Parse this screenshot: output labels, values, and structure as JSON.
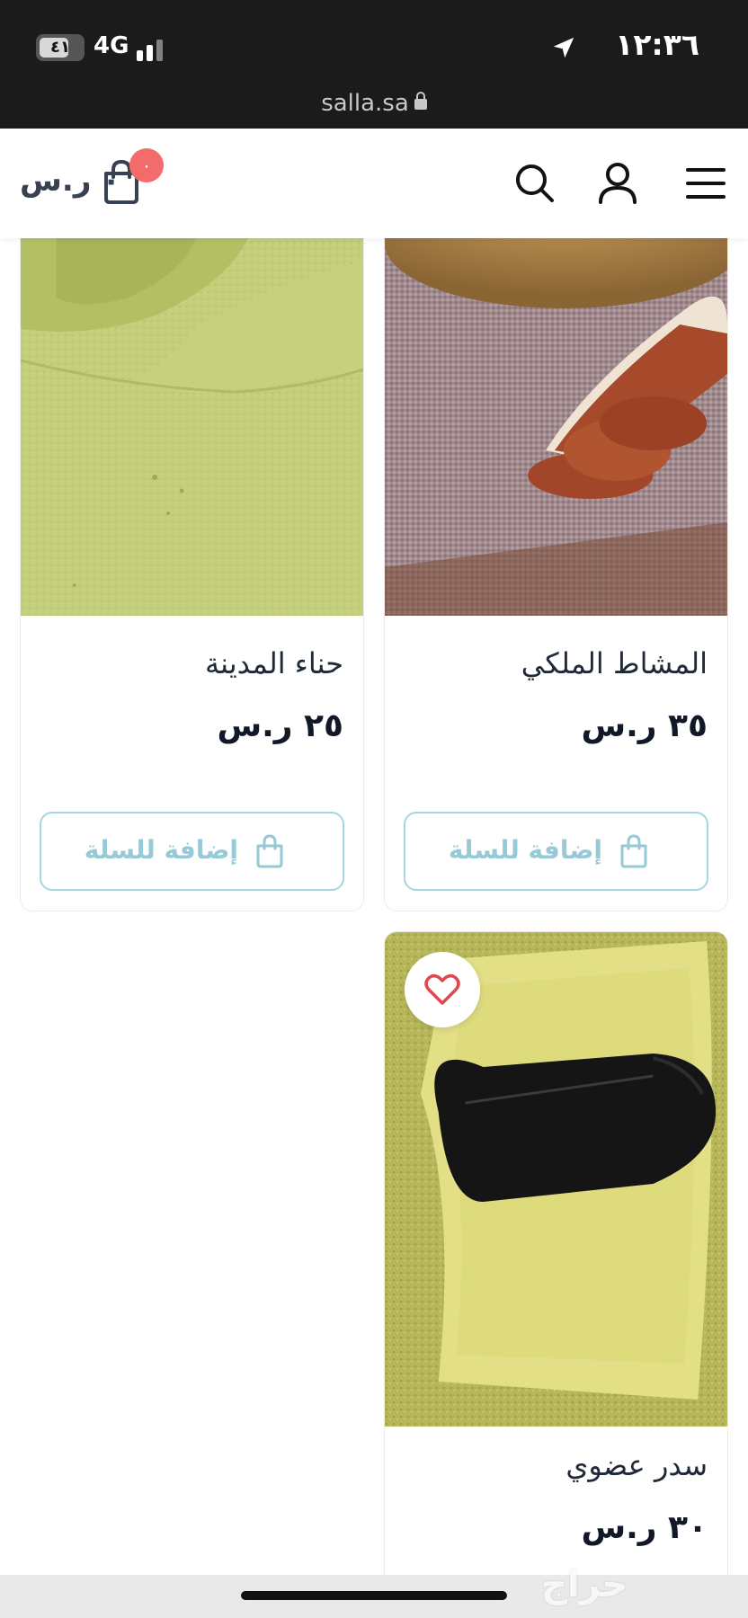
{
  "status_bar": {
    "time": "١٢:٣٦",
    "network": "4G",
    "battery": "٤١"
  },
  "browser": {
    "url": "salla.sa"
  },
  "header": {
    "cart_total": "٠ ر.س",
    "cart_count": "٠",
    "icons": [
      "menu-icon",
      "user-icon",
      "search-icon",
      "cart-icon"
    ]
  },
  "products": [
    {
      "name": "المشاط الملكي",
      "price": "٣٥ ر.س",
      "add_to_cart": "إضافة للسلة",
      "image": "red powder in wooden scoop on burlap"
    },
    {
      "name": "حناء المدينة",
      "price": "٢٥ ر.س",
      "add_to_cart": "إضافة للسلة",
      "image": "green henna powder"
    },
    {
      "name": "سدر عضوي",
      "price": "٣٠ ر.س",
      "image": "sidr powder with black scoop"
    }
  ],
  "colors": {
    "badge": "#f46b6b",
    "button_border": "#a6d6df",
    "button_text": "#95cad6",
    "favorite_heart": "#e0464e"
  },
  "watermark": "حراج"
}
